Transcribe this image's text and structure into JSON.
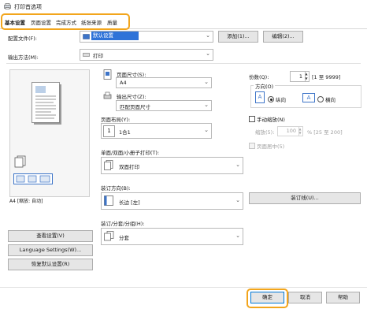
{
  "window": {
    "title": "打印首选项"
  },
  "tabs": [
    "基本设置",
    "页面设置",
    "完成方式",
    "纸张来源",
    "质量"
  ],
  "profile": {
    "label": "配置文件(F):",
    "value": "默认设置",
    "add_btn": "添加(1)...",
    "edit_btn": "编辑(2)..."
  },
  "output": {
    "label": "输出方法(M):",
    "value": "打印"
  },
  "preview": {
    "caption": "A4 [缩放: 自动]"
  },
  "page_size": {
    "label": "页面尺寸(S):",
    "value": "A4"
  },
  "output_size": {
    "label": "输出尺寸(Z):",
    "value": "匹配页面尺寸"
  },
  "layout": {
    "label": "页面布局(Y):",
    "value": "1合1",
    "icon_num": "1"
  },
  "copies": {
    "label": "份数(Q):",
    "value": "1",
    "range": "[1 至 9999]"
  },
  "orientation": {
    "label": "方向(O)",
    "portrait": "纵向",
    "landscape": "横向",
    "icon_a": "A"
  },
  "manual_scale": {
    "label": "手动缩放(N)",
    "scale_label": "缩放(5):",
    "scale_value": "100",
    "scale_range": "% [25 至 200]",
    "center": "页面居中(5)"
  },
  "duplex": {
    "label": "单面/双面/小册子打印(T):",
    "value": "双面打印"
  },
  "binding": {
    "label": "装订方向(B):",
    "value": "长边 [左]",
    "btn": "装订线(U)..."
  },
  "finishing": {
    "label": "装订/分套/分组(H):",
    "value": "分套"
  },
  "left_buttons": {
    "view": "查看设置(V)",
    "lang": "Language Settings(W)...",
    "restore": "恢复默认设置(R)"
  },
  "footer": {
    "ok": "确定",
    "cancel": "取消",
    "help": "帮助"
  }
}
